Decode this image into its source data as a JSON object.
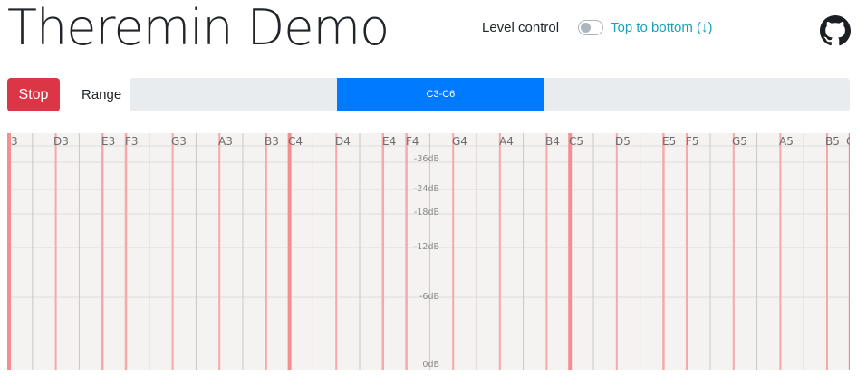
{
  "header": {
    "title": "Theremin Demo",
    "level_control_label": "Level control",
    "direction_label": "Top to bottom (↓)",
    "level_control_on": false,
    "github_icon": "github-icon"
  },
  "controls": {
    "stop_label": "Stop",
    "range_label": "Range",
    "range_value": "C3-C6",
    "range_fraction_start": 0.2878,
    "range_fraction_end": 0.5761
  },
  "keyboard": {
    "note_labels": [
      "3",
      "D3",
      "E3",
      "F3",
      "G3",
      "A3",
      "B3",
      "C4",
      "D4",
      "E4",
      "F4",
      "G4",
      "A4",
      "B4",
      "C5",
      "D5",
      "E5",
      "F5",
      "G5",
      "A5",
      "B5",
      "C"
    ],
    "db_labels": [
      "-36dB",
      "-24dB",
      "-18dB",
      "-12dB",
      "-6dB",
      "0dB"
    ],
    "colors": {
      "background": "#f4f3f2",
      "key_line": "#c8c8c8",
      "accent_line": "#f7a8a8",
      "octave_line": "#f58f8f",
      "grid_line": "#dcdcdc"
    }
  }
}
